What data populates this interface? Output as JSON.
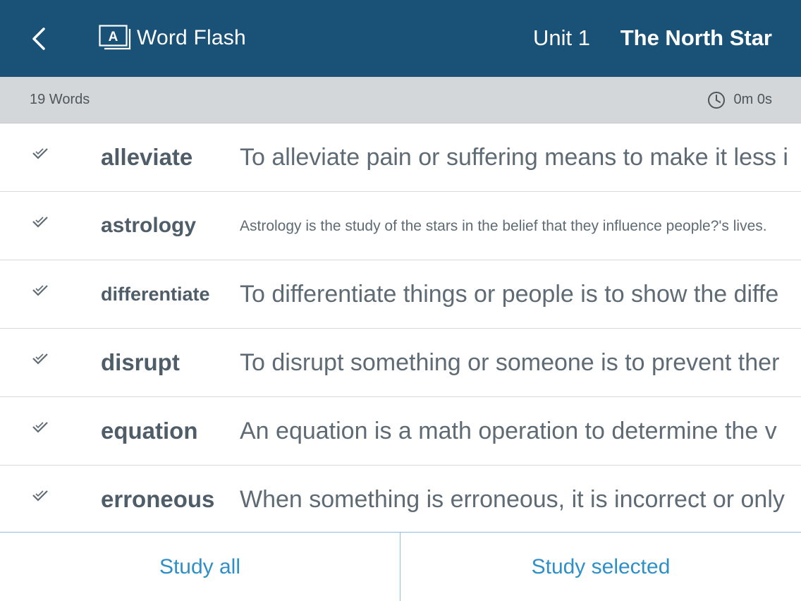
{
  "header": {
    "app_name": "Word Flash",
    "unit": "Unit 1",
    "story_title": "The North Star",
    "icons": {
      "back": "chevron-left-icon",
      "brand": "flashcard-icon"
    }
  },
  "subbar": {
    "word_count": "19 Words",
    "timer": "0m 0s",
    "timer_icon": "clock-icon"
  },
  "words": [
    {
      "word": "alleviate",
      "definition": "To alleviate pain or suffering means to make it less i",
      "checked": true
    },
    {
      "word": "astrology",
      "definition": "Astrology is the study of the stars in the belief that they influence people?'s lives.",
      "checked": true
    },
    {
      "word": "differentiate",
      "definition": "To differentiate things or people is to show the diffe",
      "checked": true
    },
    {
      "word": "disrupt",
      "definition": "To disrupt something or someone is to prevent ther",
      "checked": true
    },
    {
      "word": "equation",
      "definition": "An equation is a math operation to determine the v",
      "checked": true
    },
    {
      "word": "erroneous",
      "definition": "When something is erroneous, it is incorrect or only",
      "checked": true
    }
  ],
  "footer": {
    "study_all": "Study all",
    "study_selected": "Study selected"
  },
  "colors": {
    "header_bg": "#1a5277",
    "subbar_bg": "#d3d7da",
    "accent": "#2f8fc7",
    "word_text": "#4e5d68"
  }
}
